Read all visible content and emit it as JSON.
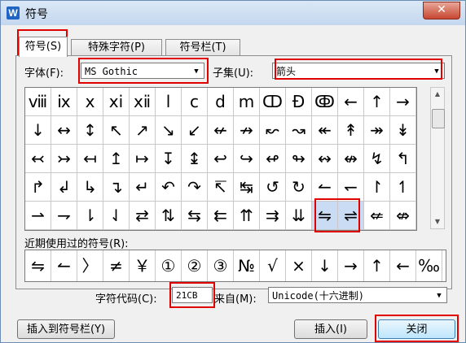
{
  "window": {
    "title": "符号",
    "app_icon": "W",
    "close_label": "✕"
  },
  "tabs": [
    {
      "label": "符号(S)"
    },
    {
      "label": "特殊字符(P)"
    },
    {
      "label": "符号栏(T)"
    }
  ],
  "font": {
    "label": "字体(F):",
    "value": "MS Gothic"
  },
  "subset": {
    "label": "子集(U):",
    "value": "箭头"
  },
  "symbols": [
    "ⅷ",
    "ⅸ",
    "x",
    "ⅹⅰ",
    "ⅹⅱ",
    "l",
    "c",
    "d",
    "m",
    "ↀ",
    "Ɖ",
    "ↂ",
    "←",
    "↑",
    "→",
    "↓",
    "↔",
    "↕",
    "↖",
    "↗",
    "↘",
    "↙",
    "↚",
    "↛",
    "↜",
    "↝",
    "↞",
    "↟",
    "↠",
    "↡",
    "↢",
    "↣",
    "↤",
    "↥",
    "↦",
    "↧",
    "↨",
    "↩",
    "↪",
    "↫",
    "↬",
    "↭",
    "↮",
    "↯",
    "↰",
    "↱",
    "↲",
    "↳",
    "↴",
    "↵",
    "↶",
    "↷",
    "↸",
    "↹",
    "↺",
    "↻",
    "↼",
    "↽",
    "↾",
    "↿",
    "⇀",
    "⇁",
    "⇂",
    "⇃",
    "⇄",
    "⇅",
    "⇆",
    "⇇",
    "⇈",
    "⇉",
    "⇊",
    "⇋",
    "⇌",
    "⇍",
    "⇎"
  ],
  "recent": {
    "label": "近期使用过的符号(R):",
    "items": [
      "⇋",
      "↼",
      "〉",
      "≠",
      "￥",
      "①",
      "②",
      "③",
      "№",
      "√",
      "×",
      "↓",
      "→",
      "↑",
      "←",
      "‰"
    ]
  },
  "char_code": {
    "label": "字符代码(C):",
    "value": "21CB"
  },
  "from": {
    "label": "来自(M):",
    "value": "Unicode(十六进制)"
  },
  "buttons": {
    "insert_to_bar": "插入到符号栏(Y)",
    "insert": "插入(I)",
    "close": "关闭"
  },
  "colors": {
    "highlight": "#e00000",
    "selected_cell": "#c9dcf3"
  }
}
